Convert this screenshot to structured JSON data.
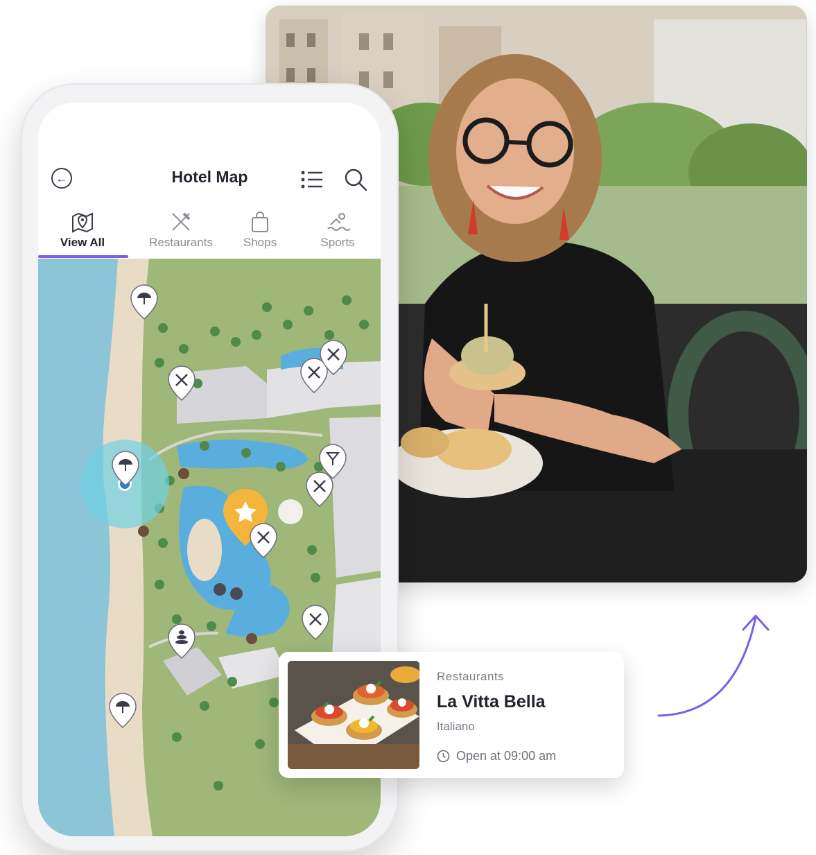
{
  "header": {
    "title": "Hotel Map",
    "back_icon": "arrow-left-circle-icon",
    "list_icon": "list-icon",
    "search_icon": "search-icon"
  },
  "tabs": [
    {
      "label": "View All",
      "icon": "map-pin-icon",
      "active": true
    },
    {
      "label": "Restaurants",
      "icon": "fork-knife-icon",
      "active": false
    },
    {
      "label": "Shops",
      "icon": "shopping-bag-icon",
      "active": false
    },
    {
      "label": "Sports",
      "icon": "swimmer-icon",
      "active": false
    }
  ],
  "card": {
    "category": "Restaurants",
    "name": "La Vitta Bella",
    "cuisine": "Italiano",
    "hours": "Open at 09:00 am",
    "hours_icon": "clock-icon"
  },
  "colors": {
    "accent": "#7d5fe0",
    "sea": "#8cc4d8",
    "grass": "#9fb779",
    "sand": "#e9dcc7",
    "pin_featured": "#f3b53b",
    "location_dot": "#2d7fd0"
  }
}
